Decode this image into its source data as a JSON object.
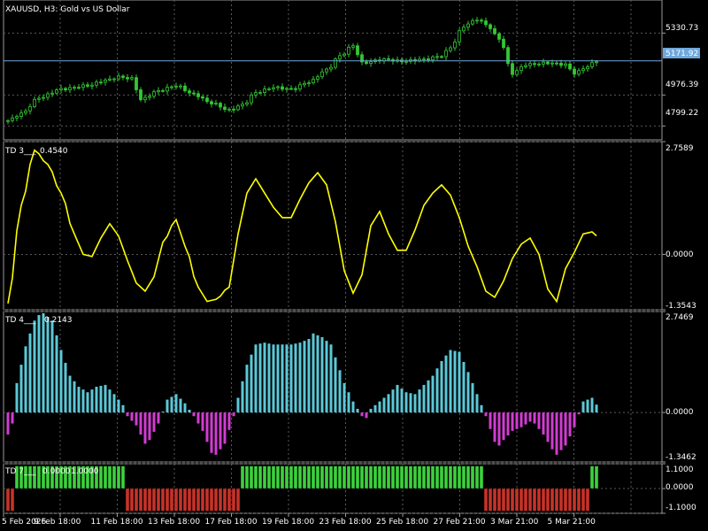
{
  "window_title": "XAUUSD, H3:  Gold vs US Dollar",
  "colors": {
    "background": "#000000",
    "grid": "#5a5a5a",
    "frame": "#9a9a9a",
    "candle_up": "#32c832",
    "candle_down": "#32c832",
    "td3_line": "#ffff00",
    "td4_positive": "#5bc8d8",
    "td4_negative": "#d23cd2",
    "td7_up": "#3cd23c",
    "td7_down": "#c83228",
    "current_price_line": "#6fa8dc",
    "current_price_badge": "#6fa8dc"
  },
  "price_axis": {
    "ticks": [
      "5330.73",
      "4976.39",
      "4799.22"
    ],
    "current_price": "5171.92"
  },
  "time_axis": {
    "labels": [
      "5 Feb 2026",
      "9 Feb 18:00",
      "11 Feb 18:00",
      "13 Feb 18:00",
      "17 Feb 18:00",
      "19 Feb 18:00",
      "23 Feb 18:00",
      "25 Feb 18:00",
      "27 Feb 21:00",
      "3 Mar 21:00",
      "5 Mar 21:00"
    ]
  },
  "indicators": {
    "td3": {
      "label": "TD 3___",
      "value": "0.4540",
      "ticks": [
        "2.7589",
        "0.0000",
        "-1.3543"
      ]
    },
    "td4": {
      "label": "TD 4___",
      "value": "0.2143",
      "ticks": [
        "2.7469",
        "0.0000",
        "-1.3462"
      ]
    },
    "td7": {
      "label": "TD 7___",
      "value1": "0.0000",
      "value2": "1.0000",
      "ticks": [
        "1.1000",
        "0.0000",
        "-1.1000"
      ]
    }
  },
  "chart_data": [
    {
      "type": "candlestick",
      "title": "XAUUSD, H3:  Gold vs US Dollar",
      "ylim": [
        4720,
        5520
      ],
      "ticks": [
        5330.73,
        4976.39,
        4799.22
      ],
      "current_price": 5171.92,
      "bars": 134,
      "close_anchors": [
        [
          0,
          4830
        ],
        [
          3,
          4870
        ],
        [
          7,
          4960
        ],
        [
          12,
          5010
        ],
        [
          18,
          5030
        ],
        [
          22,
          5060
        ],
        [
          25,
          5080
        ],
        [
          28,
          5070
        ],
        [
          30,
          4950
        ],
        [
          34,
          5000
        ],
        [
          38,
          5030
        ],
        [
          42,
          4980
        ],
        [
          46,
          4930
        ],
        [
          50,
          4890
        ],
        [
          53,
          4920
        ],
        [
          56,
          4990
        ],
        [
          60,
          5020
        ],
        [
          64,
          5010
        ],
        [
          68,
          5050
        ],
        [
          72,
          5120
        ],
        [
          75,
          5200
        ],
        [
          78,
          5260
        ],
        [
          80,
          5160
        ],
        [
          85,
          5180
        ],
        [
          89,
          5170
        ],
        [
          94,
          5180
        ],
        [
          98,
          5200
        ],
        [
          100,
          5250
        ],
        [
          103,
          5370
        ],
        [
          106,
          5410
        ],
        [
          108,
          5380
        ],
        [
          111,
          5300
        ],
        [
          114,
          5100
        ],
        [
          117,
          5150
        ],
        [
          122,
          5160
        ],
        [
          126,
          5150
        ],
        [
          128,
          5100
        ],
        [
          131,
          5140
        ],
        [
          133,
          5172
        ]
      ]
    },
    {
      "type": "line",
      "name": "TD 3",
      "ylim": [
        -1.3543,
        2.7589
      ],
      "ticks": [
        2.7589,
        0.0,
        -1.3543
      ],
      "points": [
        [
          0,
          -1.2
        ],
        [
          3,
          1.2
        ],
        [
          6,
          2.55
        ],
        [
          9,
          2.2
        ],
        [
          12,
          1.5
        ],
        [
          15,
          0.5
        ],
        [
          17,
          0.0
        ],
        [
          19,
          -0.05
        ],
        [
          21,
          0.4
        ],
        [
          23,
          0.75
        ],
        [
          25,
          0.45
        ],
        [
          27,
          -0.15
        ],
        [
          29,
          -0.7
        ],
        [
          31,
          -0.9
        ],
        [
          33,
          -0.55
        ],
        [
          35,
          0.3
        ],
        [
          38,
          0.85
        ],
        [
          40,
          0.2
        ],
        [
          43,
          -0.8
        ],
        [
          45,
          -1.15
        ],
        [
          47,
          -1.1
        ],
        [
          50,
          -0.8
        ],
        [
          52,
          0.5
        ],
        [
          54,
          1.5
        ],
        [
          56,
          1.85
        ],
        [
          58,
          1.5
        ],
        [
          60,
          1.15
        ],
        [
          62,
          0.9
        ],
        [
          64,
          0.9
        ],
        [
          66,
          1.35
        ],
        [
          68,
          1.75
        ],
        [
          70,
          2.0
        ],
        [
          72,
          1.7
        ],
        [
          74,
          0.8
        ],
        [
          76,
          -0.4
        ],
        [
          78,
          -0.95
        ],
        [
          80,
          -0.5
        ],
        [
          82,
          0.7
        ],
        [
          84,
          1.05
        ],
        [
          86,
          0.5
        ],
        [
          88,
          0.1
        ],
        [
          90,
          0.1
        ],
        [
          92,
          0.6
        ],
        [
          94,
          1.2
        ],
        [
          96,
          1.5
        ],
        [
          98,
          1.7
        ],
        [
          100,
          1.45
        ],
        [
          102,
          0.9
        ],
        [
          104,
          0.2
        ],
        [
          106,
          -0.3
        ],
        [
          108,
          -0.9
        ],
        [
          110,
          -1.05
        ],
        [
          112,
          -0.65
        ],
        [
          114,
          -0.1
        ],
        [
          116,
          0.25
        ],
        [
          118,
          0.4
        ],
        [
          120,
          0.0
        ],
        [
          122,
          -0.85
        ],
        [
          124,
          -1.15
        ],
        [
          126,
          -0.35
        ],
        [
          128,
          0.05
        ],
        [
          130,
          0.5
        ],
        [
          132,
          0.55
        ],
        [
          133,
          0.454
        ]
      ]
    },
    {
      "type": "bar",
      "name": "TD 4",
      "ylim": [
        -1.3462,
        2.7469
      ],
      "ticks": [
        2.7469,
        0.0,
        -1.3462
      ],
      "anchors": [
        [
          0,
          -0.6
        ],
        [
          1,
          -0.3
        ],
        [
          2,
          0.8
        ],
        [
          4,
          1.8
        ],
        [
          6,
          2.5
        ],
        [
          7,
          2.65
        ],
        [
          8,
          2.7
        ],
        [
          9,
          2.6
        ],
        [
          10,
          2.5
        ],
        [
          12,
          1.7
        ],
        [
          14,
          1.0
        ],
        [
          16,
          0.7
        ],
        [
          18,
          0.55
        ],
        [
          20,
          0.7
        ],
        [
          22,
          0.75
        ],
        [
          24,
          0.5
        ],
        [
          26,
          0.2
        ],
        [
          27,
          -0.1
        ],
        [
          29,
          -0.35
        ],
        [
          31,
          -0.85
        ],
        [
          32,
          -0.75
        ],
        [
          34,
          -0.3
        ],
        [
          36,
          0.35
        ],
        [
          38,
          0.5
        ],
        [
          40,
          0.25
        ],
        [
          42,
          -0.1
        ],
        [
          44,
          -0.5
        ],
        [
          46,
          -1.1
        ],
        [
          47,
          -1.15
        ],
        [
          49,
          -0.85
        ],
        [
          51,
          -0.1
        ],
        [
          52,
          0.4
        ],
        [
          54,
          1.3
        ],
        [
          56,
          1.85
        ],
        [
          58,
          1.9
        ],
        [
          60,
          1.85
        ],
        [
          64,
          1.85
        ],
        [
          66,
          1.9
        ],
        [
          68,
          2.0
        ],
        [
          69,
          2.15
        ],
        [
          71,
          2.05
        ],
        [
          73,
          1.85
        ],
        [
          74,
          1.5
        ],
        [
          76,
          0.8
        ],
        [
          78,
          0.3
        ],
        [
          80,
          -0.1
        ],
        [
          81,
          -0.15
        ],
        [
          82,
          0.1
        ],
        [
          84,
          0.3
        ],
        [
          86,
          0.5
        ],
        [
          88,
          0.75
        ],
        [
          90,
          0.55
        ],
        [
          92,
          0.5
        ],
        [
          94,
          0.75
        ],
        [
          96,
          1.0
        ],
        [
          98,
          1.4
        ],
        [
          100,
          1.7
        ],
        [
          102,
          1.65
        ],
        [
          104,
          1.1
        ],
        [
          106,
          0.5
        ],
        [
          108,
          -0.1
        ],
        [
          110,
          -0.8
        ],
        [
          111,
          -0.9
        ],
        [
          112,
          -0.75
        ],
        [
          114,
          -0.5
        ],
        [
          116,
          -0.4
        ],
        [
          118,
          -0.25
        ],
        [
          119,
          -0.3
        ],
        [
          121,
          -0.6
        ],
        [
          123,
          -1.0
        ],
        [
          124,
          -1.15
        ],
        [
          126,
          -0.9
        ],
        [
          128,
          -0.4
        ],
        [
          129,
          -0.05
        ],
        [
          130,
          0.3
        ],
        [
          132,
          0.4
        ],
        [
          133,
          0.2143
        ]
      ]
    },
    {
      "type": "bar",
      "name": "TD 7",
      "ylim": [
        -1.1,
        1.1
      ],
      "ticks": [
        1.1,
        0.0,
        -1.1
      ],
      "segments": [
        [
          0,
          1,
          -1
        ],
        [
          2,
          26,
          1
        ],
        [
          27,
          52,
          -1
        ],
        [
          53,
          107,
          1
        ],
        [
          108,
          131,
          -1
        ],
        [
          132,
          133,
          1
        ]
      ]
    }
  ]
}
